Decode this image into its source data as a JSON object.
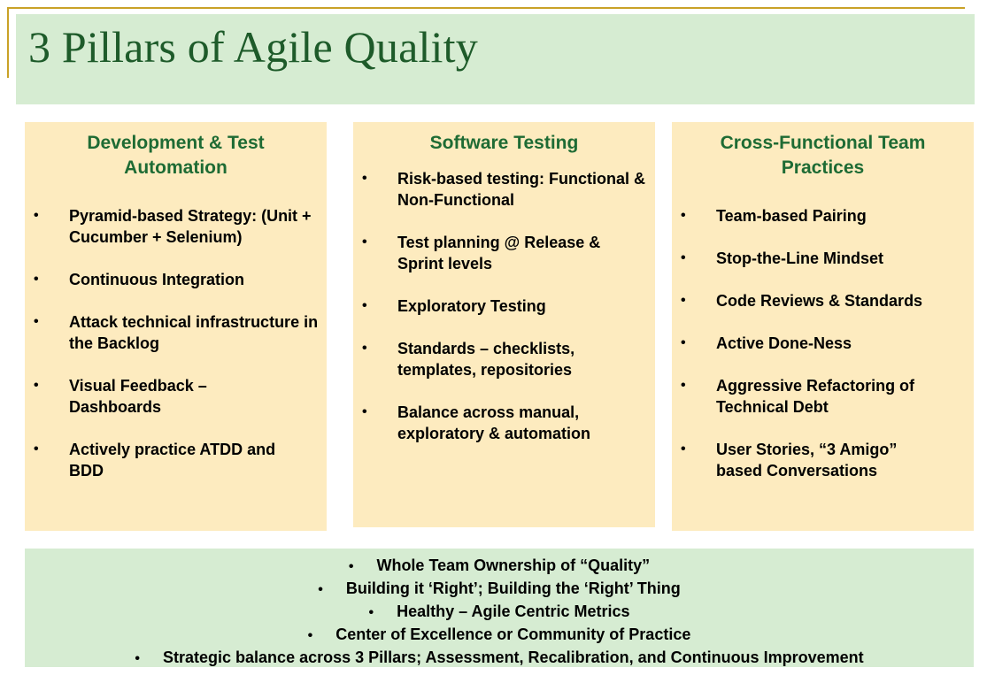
{
  "title": "3 Pillars of Agile Quality",
  "colors": {
    "title_bar": "#d6ecd2",
    "pillar": "#fdebbf",
    "heading": "#1e6b34",
    "rule": "#c9a227"
  },
  "bullet_glyph": "•",
  "pillars": [
    {
      "heading": "Development & Test Automation",
      "items": [
        "Pyramid-based Strategy: (Unit + Cucumber + Selenium)",
        "Continuous Integration",
        "Attack technical infrastructure in the Backlog",
        "Visual Feedback – Dashboards",
        "Actively practice ATDD and BDD"
      ]
    },
    {
      "heading": "Software Testing",
      "items": [
        "Risk-based testing: Functional & Non-Functional",
        "Test planning @ Release & Sprint levels",
        "Exploratory Testing",
        "Standards – checklists, templates, repositories",
        "Balance across manual, exploratory & automation"
      ]
    },
    {
      "heading": "Cross-Functional Team Practices",
      "items": [
        "Team-based Pairing",
        "Stop-the-Line Mindset",
        "Code Reviews & Standards",
        "Active Done-Ness",
        "Aggressive Refactoring of Technical Debt",
        "User Stories, “3 Amigo” based Conversations"
      ]
    }
  ],
  "foundation": [
    "Whole Team Ownership of “Quality”",
    "Building it ‘Right’; Building the ‘Right’ Thing",
    "Healthy – Agile Centric Metrics",
    "Center of Excellence or Community of Practice",
    "Strategic balance across 3 Pillars; Assessment, Recalibration, and Continuous Improvement"
  ]
}
